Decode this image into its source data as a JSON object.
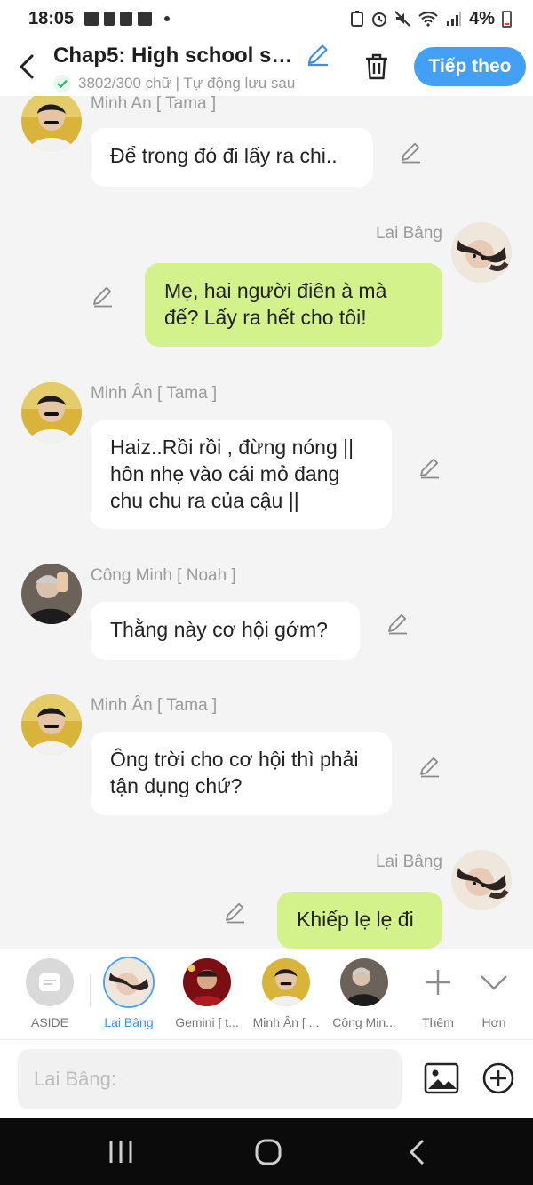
{
  "status": {
    "time": "18:05",
    "battery": "4%"
  },
  "header": {
    "title": "Chap5: High school sw...",
    "subtitle": "3802/300 chữ | Tự động lưu sau",
    "next_label": "Tiếp theo"
  },
  "messages": [
    {
      "speaker": "Minh An [ Tama ]",
      "text": "Để trong đó đi lấy ra chi..",
      "side": "left"
    },
    {
      "speaker": "Lai Bâng",
      "text": "Mẹ, hai người điên à mà để? Lấy ra hết cho tôi!",
      "side": "right"
    },
    {
      "speaker": "Minh Ân [ Tama ]",
      "text": "Haiz..Rồi rồi , đừng nóng || hôn nhẹ vào cái mỏ đang chu chu ra của cậu ||",
      "side": "left"
    },
    {
      "speaker": "Công Minh [ Noah ]",
      "text": "Thằng này cơ hội gớm?",
      "side": "left"
    },
    {
      "speaker": "Minh Ân [ Tama ]",
      "text": "Ông trời cho cơ hội thì phải tận dụng chứ?",
      "side": "left"
    },
    {
      "speaker": "Lai Bâng",
      "text": "Khiếp lẹ lẹ đi",
      "side": "right"
    }
  ],
  "characters": [
    {
      "label": "ASIDE"
    },
    {
      "label": "Lai Bâng"
    },
    {
      "label": "Gemini [ t..."
    },
    {
      "label": "Minh Ân [ ..."
    },
    {
      "label": "Công Min..."
    },
    {
      "label": "Thêm"
    },
    {
      "label": "Hơn"
    }
  ],
  "input": {
    "placeholder": "Lai Bâng:"
  },
  "colors": {
    "accent": "#43a0f5",
    "right_bubble": "#d4f28c",
    "left_bubble": "#ffffff"
  }
}
